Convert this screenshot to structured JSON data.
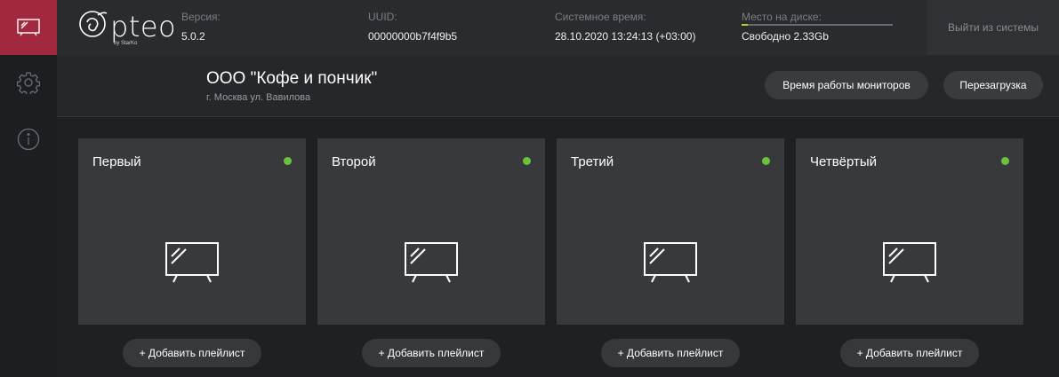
{
  "sidebar": {
    "items": [
      {
        "icon": "monitor-icon",
        "active": true
      },
      {
        "icon": "gear-icon",
        "active": false
      },
      {
        "icon": "info-icon",
        "active": false
      }
    ]
  },
  "header": {
    "logo_text": "Opteo",
    "logo_sub": "by StarKo",
    "version_label": "Версия:",
    "version_value": "5.0.2",
    "uuid_label": "UUID:",
    "uuid_value": "00000000b7f4f9b5",
    "time_label": "Системное время:",
    "time_value": "28.10.2020 13:24:13 (+03:00)",
    "disk_label": "Место на диске:",
    "disk_value": "Свободно 2.33Gb",
    "disk_used_fraction": 0.04,
    "logout_label": "Выйти из системы"
  },
  "company": {
    "name": "ООО \"Кофе и пончик\"",
    "address": "г. Москва ул. Вавилова",
    "uptime_button": "Время работы мониторов",
    "reboot_button": "Перезагрузка"
  },
  "monitors": [
    {
      "name": "Первый",
      "status": "online",
      "add_label": "+ Добавить плейлист"
    },
    {
      "name": "Второй",
      "status": "online",
      "add_label": "+ Добавить плейлист"
    },
    {
      "name": "Третий",
      "status": "online",
      "add_label": "+ Добавить плейлист"
    },
    {
      "name": "Четвёртый",
      "status": "online",
      "add_label": "+ Добавить плейлист"
    }
  ],
  "colors": {
    "accent": "#a1283e",
    "status_online": "#6bc33a",
    "disk_fill": "#b7cf25"
  }
}
